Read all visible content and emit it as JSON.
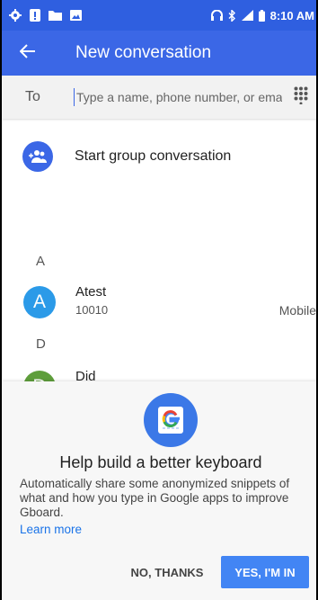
{
  "status_bar": {
    "time": "8:10 AM"
  },
  "app_bar": {
    "title": "New conversation"
  },
  "recipient": {
    "label": "To",
    "placeholder": "Type a name, phone number, or email"
  },
  "group": {
    "label": "Start group conversation"
  },
  "contacts": {
    "sections": [
      {
        "letter": "A",
        "items": [
          {
            "initial": "A",
            "name": "Atest",
            "number": "10010",
            "type": "Mobile",
            "color": "#2b9ae8"
          }
        ]
      },
      {
        "letter": "D",
        "items": [
          {
            "initial": "D",
            "name": "Did",
            "number": "",
            "type": "",
            "color": "#5e9e3b"
          }
        ]
      }
    ]
  },
  "gboard_prompt": {
    "title": "Help build a better keyboard",
    "body": "Automatically share some anonymized snippets of what and how you type in Google apps to improve Gboard.",
    "learn_more": "Learn more",
    "decline_label": "NO, THANKS",
    "accept_label": "YES, I'M IN"
  },
  "colors": {
    "status_bar": "#2f5fe0",
    "app_bar": "#3b67e6",
    "accent_button": "#4285f4",
    "link": "#1a73e8"
  },
  "icons": {
    "back": "arrow-left-icon",
    "dialpad": "dialpad-icon",
    "group": "add-group-icon",
    "gboard": "gboard-logo-icon"
  }
}
